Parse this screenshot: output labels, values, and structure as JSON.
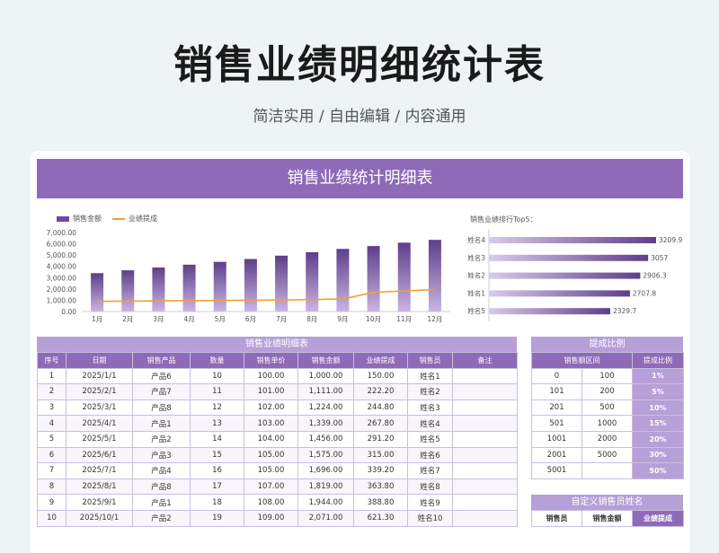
{
  "page": {
    "title": "销售业绩明细统计表",
    "subtitle": "简洁实用 / 自由编辑 / 内容通用"
  },
  "banner": {
    "title": "销售业绩统计明细表"
  },
  "chart_data": [
    {
      "type": "bar",
      "legend": [
        "销售金额",
        "业绩提成"
      ],
      "categories": [
        "1月",
        "2月",
        "3月",
        "4月",
        "5月",
        "6月",
        "7月",
        "8月",
        "9月",
        "10月",
        "11月",
        "12月"
      ],
      "series": [
        {
          "name": "销售金额",
          "type": "bar",
          "values": [
            3400,
            3650,
            3900,
            4150,
            4400,
            4650,
            4950,
            5250,
            5550,
            5800,
            6100,
            6350
          ],
          "color": "#6b4c96"
        },
        {
          "name": "业绩提成",
          "type": "line",
          "values": [
            900,
            920,
            940,
            960,
            980,
            1000,
            1020,
            1060,
            1120,
            1700,
            1820,
            1950
          ],
          "color": "#f0a030"
        }
      ],
      "yticks": [
        "7,000.00",
        "6,000.00",
        "5,000.00",
        "4,000.00",
        "3,000.00",
        "2,000.00",
        "1,000.00",
        "0.00"
      ],
      "ylim": [
        0,
        7000
      ],
      "grid": false
    },
    {
      "type": "bar",
      "orientation": "horizontal",
      "title": "销售业绩排行Top5：",
      "categories": [
        "姓名4",
        "姓名3",
        "姓名2",
        "姓名1",
        "姓名5"
      ],
      "values": [
        3209.9,
        3057,
        2906.3,
        2707.8,
        2329.7
      ],
      "labels": [
        "3209.9",
        "3057",
        "2906.3",
        "2707.8",
        "2329.7"
      ],
      "xlim": [
        0,
        3209.9
      ]
    }
  ],
  "detail": {
    "title": "销售业绩明细表",
    "headers": [
      "序号",
      "日期",
      "销售产品",
      "数量",
      "销售单价",
      "销售金额",
      "业绩提成",
      "销售员",
      "备注"
    ],
    "rows": [
      [
        "1",
        "2025/1/1",
        "产品6",
        "10",
        "100.00",
        "1,000.00",
        "150.00",
        "姓名1",
        ""
      ],
      [
        "2",
        "2025/2/1",
        "产品7",
        "11",
        "101.00",
        "1,111.00",
        "222.20",
        "姓名2",
        ""
      ],
      [
        "3",
        "2025/3/1",
        "产品8",
        "12",
        "102.00",
        "1,224.00",
        "244.80",
        "姓名3",
        ""
      ],
      [
        "4",
        "2025/4/1",
        "产品1",
        "13",
        "103.00",
        "1,339.00",
        "267.80",
        "姓名4",
        ""
      ],
      [
        "5",
        "2025/5/1",
        "产品2",
        "14",
        "104.00",
        "1,456.00",
        "291.20",
        "姓名5",
        ""
      ],
      [
        "6",
        "2025/6/1",
        "产品3",
        "15",
        "105.00",
        "1,575.00",
        "315.00",
        "姓名6",
        ""
      ],
      [
        "7",
        "2025/7/1",
        "产品4",
        "16",
        "105.00",
        "1,696.00",
        "339.20",
        "姓名7",
        ""
      ],
      [
        "8",
        "2025/8/1",
        "产品8",
        "17",
        "107.00",
        "1,819.00",
        "363.80",
        "姓名8",
        ""
      ],
      [
        "9",
        "2025/9/1",
        "产品1",
        "18",
        "108.00",
        "1,944.00",
        "388.80",
        "姓名9",
        ""
      ],
      [
        "10",
        "2025/10/1",
        "产品2",
        "19",
        "109.00",
        "2,071.00",
        "621.30",
        "姓名10",
        ""
      ]
    ]
  },
  "ratio": {
    "title": "提成比例",
    "headers": [
      "销售额区间",
      "提成比例"
    ],
    "rows": [
      [
        "0",
        "100",
        "1%"
      ],
      [
        "101",
        "200",
        "5%"
      ],
      [
        "201",
        "500",
        "10%"
      ],
      [
        "501",
        "1000",
        "15%"
      ],
      [
        "1001",
        "2000",
        "20%"
      ],
      [
        "2001",
        "5000",
        "30%"
      ],
      [
        "5001",
        "",
        "50%"
      ]
    ]
  },
  "custom": {
    "title": "自定义销售员姓名",
    "headers": [
      "销售员",
      "销售金额",
      "业绩提成"
    ]
  }
}
